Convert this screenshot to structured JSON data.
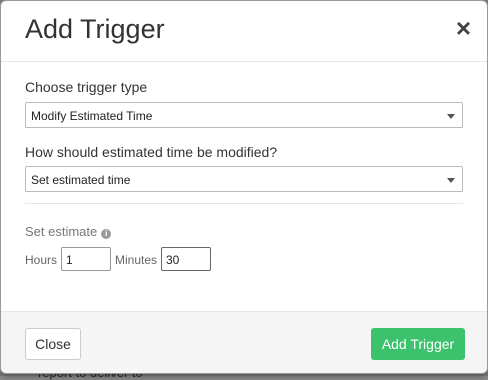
{
  "modal": {
    "title": "Add Trigger",
    "close_symbol": "×"
  },
  "trigger_type": {
    "label": "Choose trigger type",
    "selected": "Modify Estimated Time"
  },
  "modification": {
    "label": "How should estimated time be modified?",
    "selected": "Set estimated time"
  },
  "estimate": {
    "label": "Set estimate",
    "info_icon": "info-icon",
    "hours_label": "Hours",
    "hours_value": "1",
    "minutes_label": "Minutes",
    "minutes_value": "30"
  },
  "footer": {
    "close_label": "Close",
    "add_label": "Add Trigger"
  },
  "colors": {
    "primary": "#3cc26d"
  },
  "background": {
    "peek_text": "report to deliver to"
  }
}
